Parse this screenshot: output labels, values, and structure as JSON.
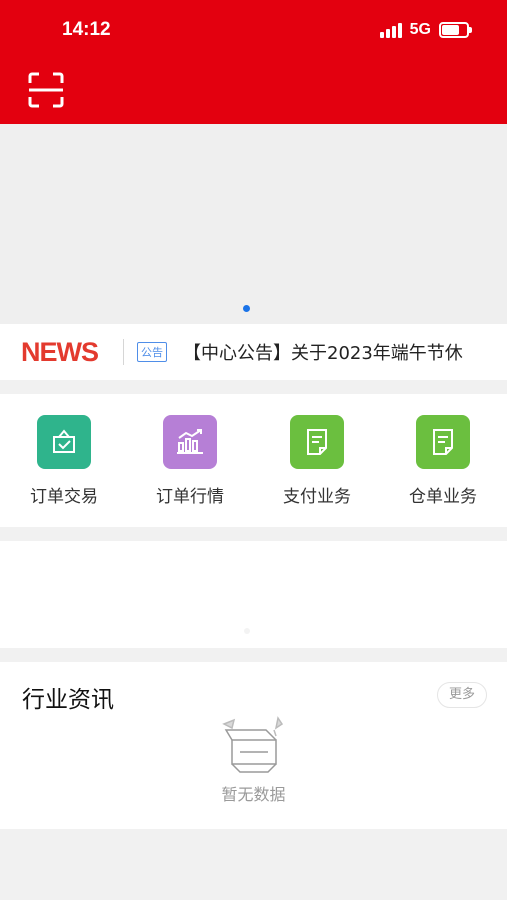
{
  "status_bar": {
    "time": "14:12",
    "network": "5G",
    "battery_level": 0.75
  },
  "header": {
    "scan_icon": "scan-icon",
    "background": "#e3000f"
  },
  "banner": {
    "indicator_active_color": "#1a73e8"
  },
  "news": {
    "logo": "NEWS",
    "tag": "公告",
    "headline": "【中心公告】关于2023年端午节休",
    "logo_color": "#e33a2e"
  },
  "menu": {
    "items": [
      {
        "label": "订单交易",
        "icon": "bag-check-icon",
        "color": "#2fb48c"
      },
      {
        "label": "订单行情",
        "icon": "bar-chart-icon",
        "color": "#b67fd6"
      },
      {
        "label": "支付业务",
        "icon": "document-icon",
        "color": "#6bbf3f"
      },
      {
        "label": "仓单业务",
        "icon": "document-icon",
        "color": "#6bbf3f"
      }
    ]
  },
  "industry": {
    "title": "行业资讯",
    "more_label": "更多",
    "empty_label": "暂无数据"
  }
}
